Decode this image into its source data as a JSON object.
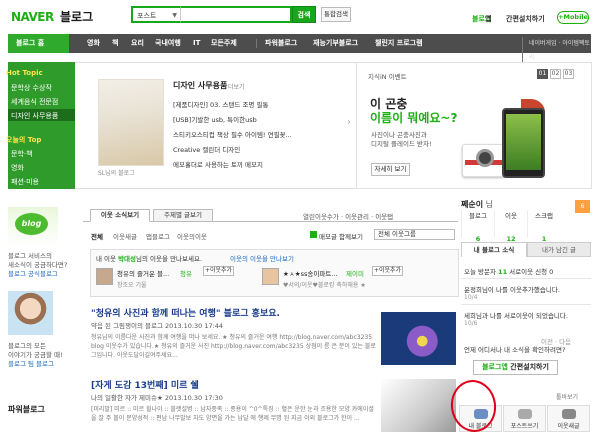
{
  "header": {
    "logo_naver": "NAVER",
    "logo_blog": "블로그",
    "search_select": "포스트",
    "search_btn": "검색",
    "total_search": "통합검색",
    "tr_naver": "블로그",
    "tr_blog": "앱",
    "tr_link": "간편설치하기",
    "mobile": "+Mobile"
  },
  "gnb": {
    "home": "블로그 홈",
    "items": [
      "영화",
      "책",
      "요리",
      "국내여행",
      "IT",
      "모든주제",
      "파워블로그",
      "재능기부블로그",
      "챌린지 프로그램"
    ],
    "right": "네이버게임 · 아이템팩토리"
  },
  "hot": {
    "h1": "Hot Topic",
    "items": [
      "문학상 수상작",
      "세계음식 전문점",
      "디자인 사무용품"
    ],
    "h2": "오늘의 Top",
    "items2": [
      "문학·책",
      "영화",
      "패션·미용"
    ]
  },
  "banner": {
    "caption": "SL님의 블로그",
    "title": "디자인 사무용품",
    "more": "더보기",
    "items": [
      "[제품디자인] 03. 스탠드 조명 필통",
      "[USB]기발한 usb, 특이한usb",
      "스티키오스티컵 책상 필수 아이템! 연필꽂...",
      "Creative 캘린더 디자인",
      "메모홀더로 사용하는 토끼 메모지"
    ]
  },
  "jisik": {
    "label": "지식iN 이벤트",
    "pages": [
      "01",
      "02",
      "03"
    ],
    "t1": "이 곤충",
    "t2": "이름이 뭐예요~?",
    "s1": "사진이나 곤충사진과",
    "s2": "디지털 플레이드 받자!",
    "btn": "자세히 보기"
  },
  "left": {
    "blog_text1": "블로그 서비스의",
    "blog_text2": "새소식이 궁금하다면?",
    "blog_text3": "블로그 공식블로그",
    "avatar_text1": "블로그의 모든",
    "avatar_text2": "이야기가 궁금할 때!",
    "avatar_text3": "블로그 팀 블로그",
    "power": "파워블로그"
  },
  "center": {
    "tab1": "이웃 소식보기",
    "tab2": "주제별 글보기",
    "right_links": "열린이웃수가 · 이웃관리 · 이웃탭",
    "subs": [
      "전체",
      "이웃새글",
      "앱블로그",
      "이웃의이웃"
    ],
    "checkbox": "매모글 함께보기",
    "sort": "전체 이웃그룹",
    "neigh_head_pre": "내 이웃 ",
    "neigh_head_name": "박대성",
    "neigh_head_post": "님의 이웃을 만나보세요.",
    "neigh_link": "이웃의 이웃을 만나보기",
    "neighbors": [
      {
        "name": "청유의 즐거운 블...",
        "tag": "청유",
        "btn": "+이웃추가",
        "sub": "창조오 기울"
      },
      {
        "name": "★ㅅ★ss송이파트...",
        "tag": "제이미",
        "btn": "+이웃추가",
        "sub": "♥서의/이웃♥블로킹 축하해용 ★"
      }
    ],
    "post1": {
      "title": "\"청유의 사진과 함께 떠나는 여행\" 블로그 홍보요.",
      "sub": "약음 된 그림쟁이의 블로그   2013.10.30 17:44",
      "body": "청유님의 이름다운 사진과 함께 여행을 떠나 보세요. ★ 청유의 즐거운 여행 http://blog.naver.com/abc3235 blog 이웃수가 있습니다.★ 청유의 즐거운 사진 http://blog.naver.com/abc3235 상점이 릉 은 분이 있는 블로그입니다. 이웃도달이길여주세요..."
    },
    "post2": {
      "title": "[자게 도감 13번째] 미르 쉘",
      "sub": "나의 일활한 자가 제미슈★   2013.10.30 17:30",
      "body": "[미리말] 미르 :: 미르 힐나이 :: 블랫설병 :: 남자종족 :: 종용이 ^0^특징 :: 혈은 운한 눈과 조용한 모양 카에이셜을 잘 주 볼이 문양성적 :: 편남 나무발보 차도 양면을 가는 남달 에 행제 무명 된 지금 이외 블로그가 한이 ..."
    }
  },
  "right": {
    "name": "쩨순이",
    "name_sfx": " 님",
    "count": "6",
    "stats": [
      {
        "label": "블로그",
        "n": "6"
      },
      {
        "label": "이웃",
        "n": "12"
      },
      {
        "label": "스크랩",
        "n": "1"
      }
    ],
    "tab1": "내 블로그 소식",
    "tab2": "내가 남긴 글",
    "line1_pre": "오늘 방문자 ",
    "line1_n": "11",
    "line1_post": "   서로이웃 신청 0",
    "line2": "윤정희님이 나를 이웃추가했습니다.",
    "line2_sm": "10/4",
    "line3": "세희님과 나를 서로이웃이 되었습니다.",
    "line3_sm": "10/6",
    "nav": "이전 · 다음",
    "q": "언제 어디서나 내 소식을 확인하려면?",
    "install_green": "블로그앱",
    "install_black": "간편설치하기",
    "tool": "툴바보기",
    "quick": [
      "내 블로그",
      "포스트쓰기",
      "이웃새글"
    ]
  },
  "colors": {
    "green": "#1daf14",
    "gnb": "#4d4d4d",
    "hot": "#2f9b2b",
    "circle": "#e0001a"
  }
}
